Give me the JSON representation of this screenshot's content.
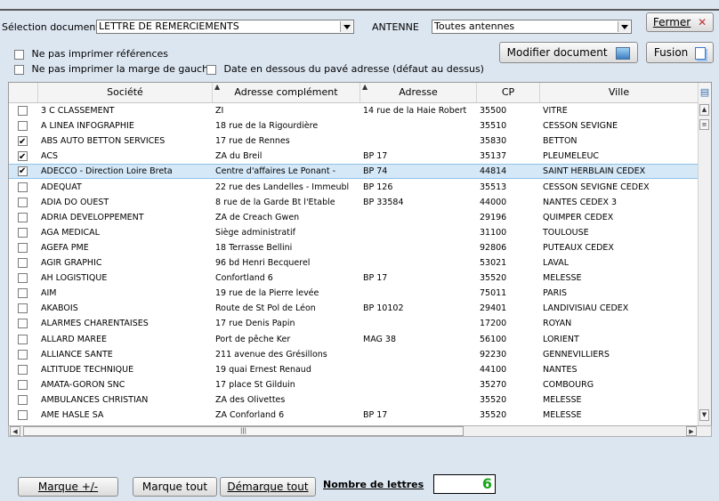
{
  "toolbar": {
    "selection_label": "Sélection document",
    "selection_value": "LETTRE DE REMERCIEMENTS",
    "antenne_label": "ANTENNE",
    "antenne_value": "Toutes antennes",
    "fermer_label": "Fermer",
    "modifier_label": "Modifier document",
    "fusion_label": "Fusion"
  },
  "options": {
    "no_refs": "Ne pas imprimer références",
    "no_margin": "Ne pas imprimer la marge de gauche",
    "date_below": "Date en dessous du pavé adresse (défaut au dessus)"
  },
  "grid": {
    "columns": [
      "Société",
      "Adresse complément",
      "Adresse",
      "CP",
      "Ville"
    ],
    "rows": [
      {
        "checked": false,
        "societe": "3 C CLASSEMENT",
        "complement": "ZI",
        "adresse": "14 rue de la Haie Robert",
        "cp": "35500",
        "ville": "VITRE"
      },
      {
        "checked": false,
        "societe": "A LINEA INFOGRAPHIE",
        "complement": "18 rue de la Rigourdière",
        "adresse": "",
        "cp": "35510",
        "ville": "CESSON SEVIGNE"
      },
      {
        "checked": true,
        "societe": "ABS AUTO BETTON SERVICES",
        "complement": "17 rue de Rennes",
        "adresse": "",
        "cp": "35830",
        "ville": "BETTON"
      },
      {
        "checked": true,
        "societe": "ACS",
        "complement": "ZA du Breil",
        "adresse": "BP 17",
        "cp": "35137",
        "ville": "PLEUMELEUC"
      },
      {
        "checked": true,
        "societe": "ADECCO - Direction Loire Breta",
        "complement": "Centre d'affaires Le Ponant -",
        "adresse": "BP 74",
        "cp": "44814",
        "ville": "SAINT HERBLAIN CEDEX"
      },
      {
        "checked": false,
        "societe": "ADEQUAT",
        "complement": "22 rue des Landelles - Immeubl",
        "adresse": "BP 126",
        "cp": "35513",
        "ville": "CESSON SEVIGNE CEDEX"
      },
      {
        "checked": false,
        "societe": "ADIA DO OUEST",
        "complement": "8 rue de la Garde  Bt l'Etable",
        "adresse": "BP 33584",
        "cp": "44000",
        "ville": "NANTES CEDEX 3"
      },
      {
        "checked": false,
        "societe": "ADRIA DEVELOPPEMENT",
        "complement": "ZA de Creach Gwen",
        "adresse": "",
        "cp": "29196",
        "ville": "QUIMPER CEDEX"
      },
      {
        "checked": false,
        "societe": "AGA MEDICAL",
        "complement": "Siège administratif",
        "adresse": "",
        "cp": "31100",
        "ville": "TOULOUSE"
      },
      {
        "checked": false,
        "societe": "AGEFA PME",
        "complement": "18 Terrasse Bellini",
        "adresse": "",
        "cp": "92806",
        "ville": "PUTEAUX CEDEX"
      },
      {
        "checked": false,
        "societe": "AGIR GRAPHIC",
        "complement": "96 bd Henri Becquerel",
        "adresse": "",
        "cp": "53021",
        "ville": "LAVAL"
      },
      {
        "checked": false,
        "societe": "AH LOGISTIQUE",
        "complement": "Confortland 6",
        "adresse": "BP 17",
        "cp": "35520",
        "ville": "MELESSE"
      },
      {
        "checked": false,
        "societe": "AIM",
        "complement": "19 rue de la Pierre levée",
        "adresse": "",
        "cp": "75011",
        "ville": "PARIS"
      },
      {
        "checked": false,
        "societe": "AKABOIS",
        "complement": "Route de St Pol de Léon",
        "adresse": "BP 10102",
        "cp": "29401",
        "ville": "LANDIVISIAU CEDEX"
      },
      {
        "checked": false,
        "societe": "ALARMES CHARENTAISES",
        "complement": "17 rue Denis Papin",
        "adresse": "",
        "cp": "17200",
        "ville": "ROYAN"
      },
      {
        "checked": false,
        "societe": "ALLARD MAREE",
        "complement": "Port de pêche Ker",
        "adresse": "MAG 38",
        "cp": "56100",
        "ville": "LORIENT"
      },
      {
        "checked": false,
        "societe": "ALLIANCE SANTE",
        "complement": "211 avenue des Grésillons",
        "adresse": "",
        "cp": "92230",
        "ville": "GENNEVILLIERS"
      },
      {
        "checked": false,
        "societe": "ALTITUDE TECHNIQUE",
        "complement": "19 quai Ernest Renaud",
        "adresse": "",
        "cp": "44100",
        "ville": "NANTES"
      },
      {
        "checked": false,
        "societe": "AMATA-GORON SNC",
        "complement": "17 place St Gilduin",
        "adresse": "",
        "cp": "35270",
        "ville": "COMBOURG"
      },
      {
        "checked": false,
        "societe": "AMBULANCES CHRISTIAN",
        "complement": "ZA des Olivettes",
        "adresse": "",
        "cp": "35520",
        "ville": "MELESSE"
      },
      {
        "checked": false,
        "societe": "AME HASLE SA",
        "complement": "ZA Conforland 6",
        "adresse": "BP 17",
        "cp": "35520",
        "ville": "MELESSE"
      }
    ],
    "selected_index": 4
  },
  "footer": {
    "marque_pm": "Marque +/-",
    "marque_tout": "Marque tout",
    "demarque_tout": "Démarque tout",
    "nombre_label": "Nombre de lettres",
    "nombre_value": "6"
  },
  "icons": {
    "close": "close-x-icon",
    "modifier": "image-edit-icon",
    "fusion": "merge-documents-icon",
    "column_picker": "column-picker-icon"
  }
}
